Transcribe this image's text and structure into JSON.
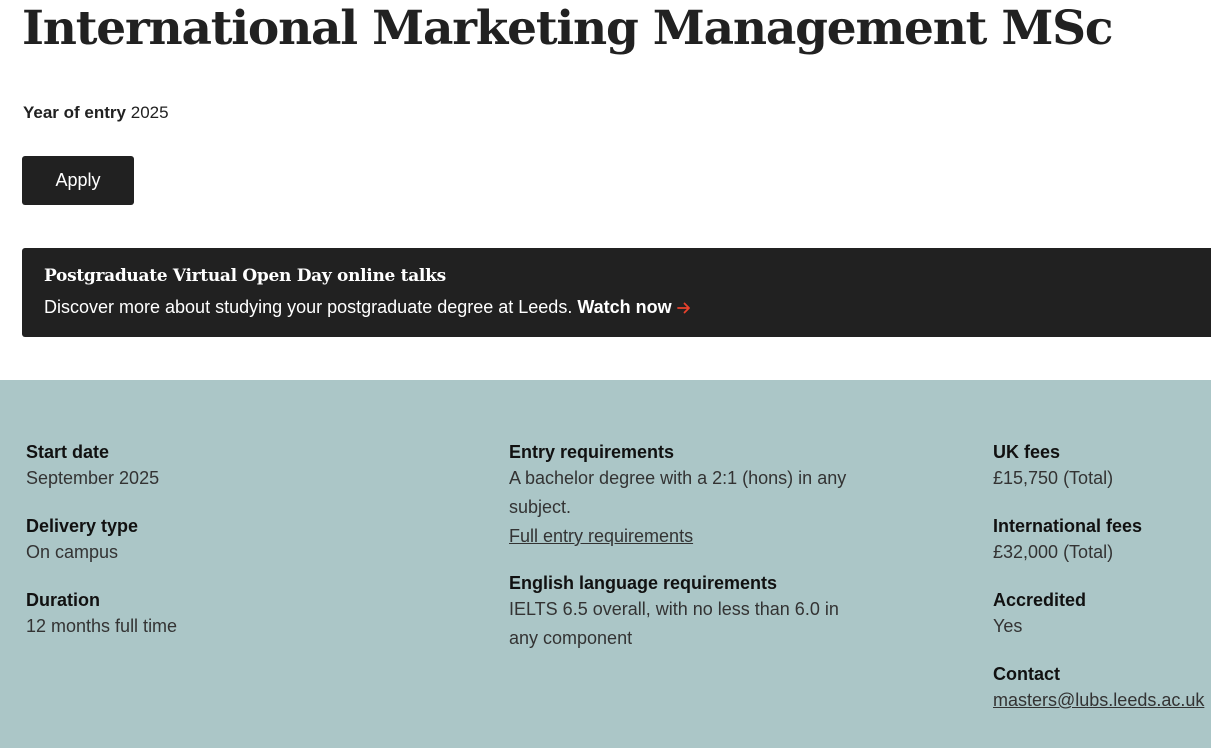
{
  "header": {
    "title": "International Marketing Management MSc",
    "year_label": "Year of entry",
    "year_value": "2025",
    "apply_label": "Apply"
  },
  "banner": {
    "title": "Postgraduate Virtual Open Day online talks",
    "text": "Discover more about studying your postgraduate degree at Leeds.",
    "link_label": "Watch now",
    "arrow_icon": "arrow-right-icon",
    "arrow_color": "#e8412c",
    "background": "#212121"
  },
  "facts": {
    "background": "#abc6c7",
    "start_date": {
      "label": "Start date",
      "value": "September 2025"
    },
    "delivery_type": {
      "label": "Delivery type",
      "value": "On campus"
    },
    "duration": {
      "label": "Duration",
      "value": "12 months full time"
    },
    "entry_requirements": {
      "label": "Entry requirements",
      "value": "A bachelor degree with a 2:1 (hons) in any subject.",
      "link_label": "Full entry requirements"
    },
    "english_requirements": {
      "label": "English language requirements",
      "value": "IELTS 6.5 overall, with no less than 6.0 in any component"
    },
    "uk_fees": {
      "label": "UK fees",
      "value": "£15,750 (Total)"
    },
    "international_fees": {
      "label": "International fees",
      "value": "£32,000 (Total)"
    },
    "accredited": {
      "label": "Accredited",
      "value": "Yes"
    },
    "contact": {
      "label": "Contact",
      "value": "masters@lubs.leeds.ac.uk"
    }
  }
}
